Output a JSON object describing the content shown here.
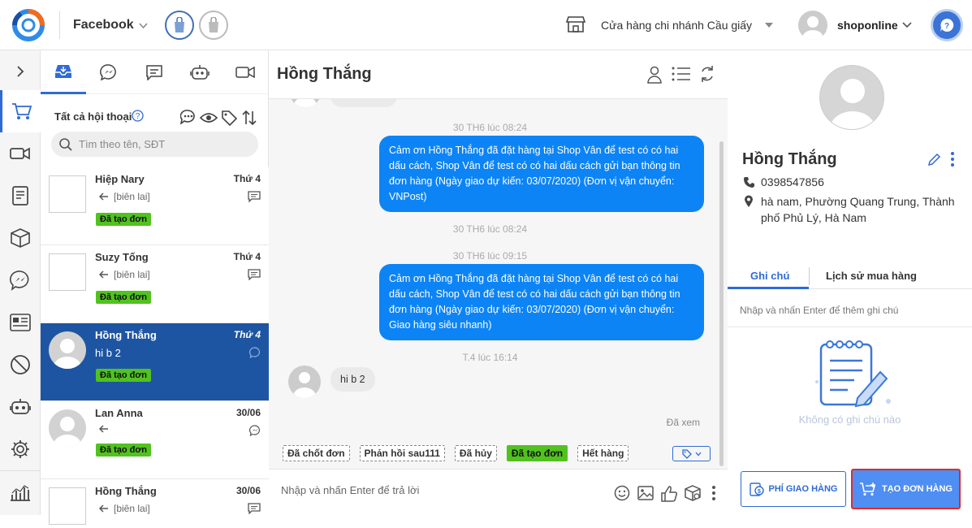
{
  "topbar": {
    "page_name": "Facebook",
    "store_name": "Cửa hàng chi nhánh Cầu giấy",
    "user_name": "shoponline",
    "accent": "#2e6bd6"
  },
  "leftnav": {
    "icons": [
      "chevron-right-icon",
      "cart-icon",
      "video-icon",
      "document-icon",
      "box-icon",
      "messenger-icon",
      "id-card-icon",
      "ban-icon",
      "robot-icon",
      "gear-icon",
      "bar-chart-icon"
    ]
  },
  "conversations": {
    "tabs": [
      "inbox-icon",
      "messenger-icon",
      "comment-icon",
      "robot-icon",
      "video-icon"
    ],
    "header": "Tất cả hội thoại",
    "search_placeholder": "Tìm theo tên, SĐT",
    "items": [
      {
        "name": "Hiệp Nary",
        "date": "Thứ 4",
        "message": "[biên lai]",
        "tag": "Đã tạo đơn",
        "avatar": "broken-image",
        "source": "comment"
      },
      {
        "name": "Suzy Tống",
        "date": "Thứ 4",
        "message": "[biên lai]",
        "tag": "Đã tạo đơn",
        "avatar": "broken-image",
        "source": "comment"
      },
      {
        "name": "Hồng Thắng",
        "date": "Thứ 4",
        "message": "hi b 2",
        "tag": "Đã tạo đơn",
        "avatar": "circle",
        "source": "messenger",
        "active": true
      },
      {
        "name": "Lan Anna",
        "date": "30/06",
        "message": "",
        "tag": "Đã tạo đơn",
        "avatar": "circle",
        "source": "messenger"
      },
      {
        "name": "Hồng Thắng",
        "date": "30/06",
        "message": "[biên lai]",
        "tag": "",
        "avatar": "broken-image",
        "source": "comment"
      }
    ]
  },
  "chat": {
    "title": "Hồng Thắng",
    "timestamps": [
      "30 TH6 lúc 08:24",
      "30 TH6 lúc 08:24",
      "30 TH6 lúc 09:15",
      "T.4 lúc 16:14"
    ],
    "messages_out": [
      "Cảm ơn Hồng Thắng đã đặt hàng tại Shop Vân để test có có hai dấu cách, Shop Vân để test có có hai dấu cách gửi bạn thông tin đơn hàng (Ngày giao dự kiến: 03/07/2020) (Đơn vị vận chuyển: VNPost)",
      "Cảm ơn Hồng Thắng đã đặt hàng tại Shop Vân để test có có hai dấu cách, Shop Vân để test có có hai dấu cách gửi bạn thông tin đơn hàng (Ngày giao dự kiến: 03/07/2020) (Đơn vị vận chuyển: Giao hàng siêu nhanh)"
    ],
    "message_in": "hi b 2",
    "seen": "Đã xem",
    "quick_tags": [
      "Đã chốt đơn",
      "Phản hồi sau111",
      "Đã hủy",
      "Đã tạo đơn",
      "Hết hàng"
    ],
    "input_placeholder": "Nhập và nhấn Enter để trả lời"
  },
  "customer": {
    "name": "Hồng Thắng",
    "phone": "0398547856",
    "address": "hà nam, Phường Quang Trung, Thành phố Phủ Lý, Hà Nam",
    "tabs": [
      "Ghi chú",
      "Lịch sử mua hàng"
    ],
    "note_placeholder": "Nhập và nhấn Enter để thêm ghi chú",
    "empty_notes": "Không có ghi chú nào",
    "fee_button": "PHÍ GIAO HÀNG",
    "create_order_button": "TẠO ĐƠN HÀNG"
  }
}
